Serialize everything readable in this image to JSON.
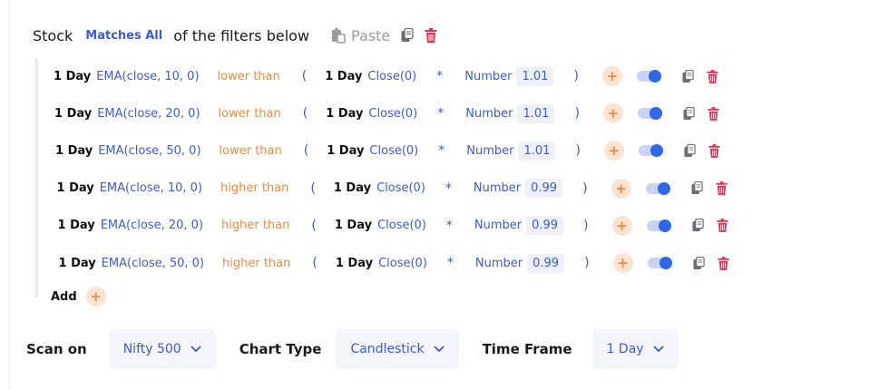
{
  "header": {
    "stock_label": "Stock",
    "matches_label": "Matches All",
    "filters_text": "of the filters below",
    "paste_label": "Paste"
  },
  "rows": [
    {
      "timeframe": "1 Day",
      "indicator": "EMA(close, 10, 0)",
      "operator": "lower than",
      "paren_open": "(",
      "timeframe2": "1 Day",
      "indicator2": "Close(0)",
      "mult": "*",
      "number_label": "Number",
      "number_value": "1.01",
      "paren_close": ")",
      "plus": "+",
      "enabled": true
    },
    {
      "timeframe": "1 Day",
      "indicator": "EMA(close, 20, 0)",
      "operator": "lower than",
      "paren_open": "(",
      "timeframe2": "1 Day",
      "indicator2": "Close(0)",
      "mult": "*",
      "number_label": "Number",
      "number_value": "1.01",
      "paren_close": ")",
      "plus": "+",
      "enabled": true
    },
    {
      "timeframe": "1 Day",
      "indicator": "EMA(close, 50, 0)",
      "operator": "lower than",
      "paren_open": "(",
      "timeframe2": "1 Day",
      "indicator2": "Close(0)",
      "mult": "*",
      "number_label": "Number",
      "number_value": "1.01",
      "paren_close": ")",
      "plus": "+",
      "enabled": true
    },
    {
      "timeframe": "1 Day",
      "indicator": "EMA(close, 10, 0)",
      "operator": "higher than",
      "paren_open": "(",
      "timeframe2": "1 Day",
      "indicator2": "Close(0)",
      "mult": "*",
      "number_label": "Number",
      "number_value": "0.99",
      "paren_close": ")",
      "plus": "+",
      "enabled": true
    },
    {
      "timeframe": "1 Day",
      "indicator": "EMA(close, 20, 0)",
      "operator": "higher than",
      "paren_open": "(",
      "timeframe2": "1 Day",
      "indicator2": "Close(0)",
      "mult": "*",
      "number_label": "Number",
      "number_value": "0.99",
      "paren_close": ")",
      "plus": "+",
      "enabled": true
    },
    {
      "timeframe": "1 Day",
      "indicator": "EMA(close, 50, 0)",
      "operator": "higher than",
      "paren_open": "(",
      "timeframe2": "1 Day",
      "indicator2": "Close(0)",
      "mult": "*",
      "number_label": "Number",
      "number_value": "0.99",
      "paren_close": ")",
      "plus": "+",
      "enabled": true
    }
  ],
  "add": {
    "label": "Add",
    "plus": "+"
  },
  "footer": {
    "scan_on_label": "Scan on",
    "scan_on_value": "Nifty 500",
    "chart_type_label": "Chart Type",
    "chart_type_value": "Candlestick",
    "time_frame_label": "Time Frame",
    "time_frame_value": "1 Day"
  },
  "icons": {
    "paste": "clipboard-paste-icon",
    "copy": "copy-icon",
    "delete": "trash-icon",
    "chevron": "chevron-down-icon"
  },
  "colors": {
    "accent": "#3b5bdb",
    "operator": "#f08a3e",
    "delete": "#e03151",
    "toggle": "#2f66ea"
  }
}
